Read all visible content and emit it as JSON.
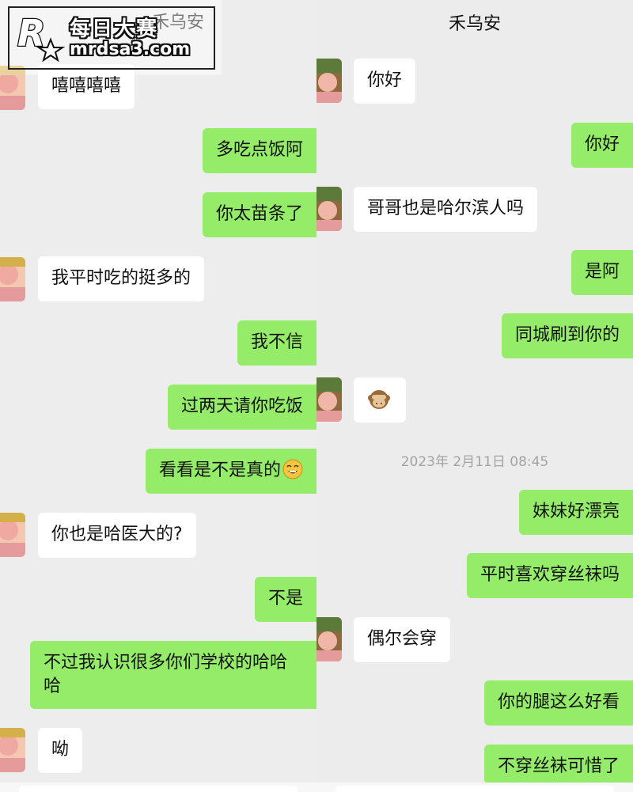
{
  "left_panel": {
    "title": "禾乌安",
    "messages": [
      {
        "side": "in",
        "text": "嘻嘻嘻嘻"
      },
      {
        "side": "out",
        "text": "多吃点饭阿"
      },
      {
        "side": "out",
        "text": "你太苗条了"
      },
      {
        "side": "in",
        "text": "我平时吃的挺多的"
      },
      {
        "side": "out",
        "text": "我不信"
      },
      {
        "side": "out",
        "text": "过两天请你吃饭"
      },
      {
        "side": "out",
        "text": "看看是不是真的",
        "emoji": "grinning-face-icon"
      },
      {
        "side": "in",
        "text": "你也是哈医大的?"
      },
      {
        "side": "out",
        "text": "不是"
      },
      {
        "side": "out",
        "text": "不过我认识很多你们学校的哈哈哈"
      },
      {
        "side": "in",
        "text": "呦"
      }
    ]
  },
  "right_panel": {
    "title": "禾乌安",
    "messages": [
      {
        "side": "in",
        "text": "你好"
      },
      {
        "side": "out",
        "text": "你好"
      },
      {
        "side": "in",
        "text": "哥哥也是哈尔滨人吗"
      },
      {
        "side": "out",
        "text": "是阿"
      },
      {
        "side": "out",
        "text": "同城刷到你的"
      },
      {
        "side": "in",
        "text": "",
        "emoji": "see-no-evil-monkey-icon"
      },
      {
        "side": "out",
        "text": "妹妹好漂亮"
      },
      {
        "side": "out",
        "text": "平时喜欢穿丝袜吗"
      },
      {
        "side": "in",
        "text": "偶尔会穿"
      },
      {
        "side": "out",
        "text": "你的腿这么好看"
      },
      {
        "side": "out",
        "text": "不穿丝袜可惜了"
      }
    ],
    "timestamp": "2023年 2月11日 08:45"
  },
  "watermark": {
    "logo_letter": "R",
    "cn_text": "每日大赛",
    "url_text": "mrdsa3.com"
  },
  "colors": {
    "incoming_bubble": "#ffffff",
    "outgoing_bubble": "#95ec69",
    "background": "#ededed",
    "timestamp_text": "#a3a3a3"
  }
}
